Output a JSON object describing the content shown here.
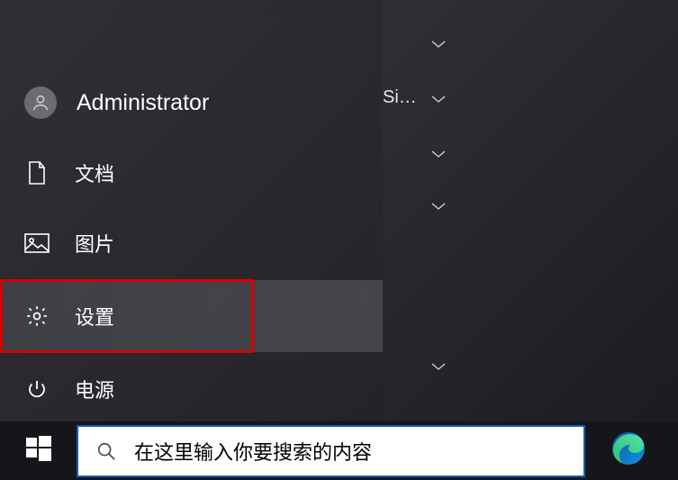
{
  "start_menu": {
    "user": {
      "name": "Administrator"
    },
    "items": {
      "documents": {
        "label": "文档"
      },
      "pictures": {
        "label": "图片"
      },
      "settings": {
        "label": "设置"
      },
      "power": {
        "label": "电源"
      }
    }
  },
  "right_area": {
    "truncated_text": "Si…"
  },
  "taskbar": {
    "search_placeholder": "在这里输入你要搜索的内容"
  },
  "colors": {
    "highlight_border": "#d80000",
    "search_border": "#0f5fb8"
  }
}
